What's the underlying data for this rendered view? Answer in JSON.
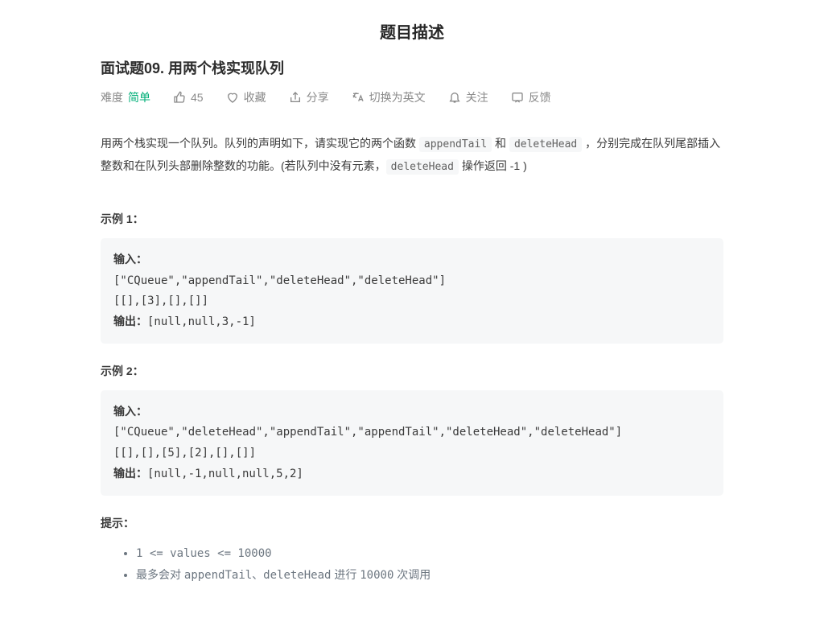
{
  "page_heading": "题目描述",
  "problem_title": "面试题09. 用两个栈实现队列",
  "meta": {
    "difficulty_label": "难度",
    "difficulty_value": "简单",
    "likes": "45",
    "favorite": "收藏",
    "share": "分享",
    "switch_lang": "切换为英文",
    "follow": "关注",
    "feedback": "反馈"
  },
  "description": {
    "part1": "用两个栈实现一个队列。队列的声明如下，请实现它的两个函数 ",
    "code1": "appendTail",
    "part2": " 和 ",
    "code2": "deleteHead",
    "part3": " ，分别完成在队列尾部插入整数和在队列头部删除整数的功能。(若队列中没有元素，",
    "code3": "deleteHead",
    "part4": " 操作返回 -1 )"
  },
  "example1_label": "示例 1：",
  "example1": {
    "input_label": "输入：",
    "input_l1": "[\"CQueue\",\"appendTail\",\"deleteHead\",\"deleteHead\"]",
    "input_l2": "[[],[3],[],[]]",
    "output_label": "输出：",
    "output_val": "[null,null,3,-1]"
  },
  "example2_label": "示例 2：",
  "example2": {
    "input_label": "输入：",
    "input_l1": "[\"CQueue\",\"deleteHead\",\"appendTail\",\"appendTail\",\"deleteHead\",\"deleteHead\"]",
    "input_l2": "[[],[],[5],[2],[],[]]",
    "output_label": "输出：",
    "output_val": "[null,-1,null,null,5,2]"
  },
  "hints_label": "提示：",
  "hints": {
    "h1": "1 <= values <= 10000",
    "h2_a": "最多会对 ",
    "h2_b": "appendTail、deleteHead",
    "h2_c": " 进行 ",
    "h2_d": "10000",
    "h2_e": " 次调用"
  }
}
